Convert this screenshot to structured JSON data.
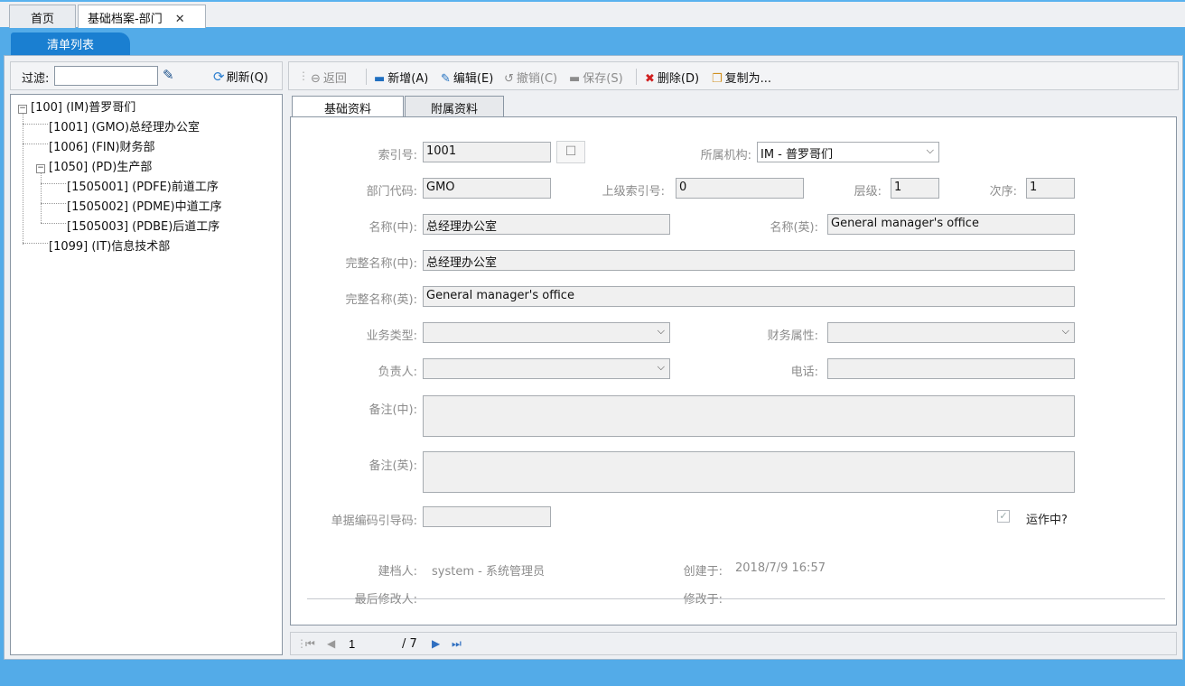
{
  "doc_tabs": [
    {
      "label": "首页"
    },
    {
      "label": "基础档案-部门"
    }
  ],
  "list_tab": "清单列表",
  "filter": {
    "label": "过滤:",
    "value": "",
    "refresh": "刷新(Q)"
  },
  "tree": [
    {
      "label": "[100] (IM)普罗哥们"
    },
    {
      "label": "[1001] (GMO)总经理办公室"
    },
    {
      "label": "[1006] (FIN)财务部"
    },
    {
      "label": "[1050] (PD)生产部"
    },
    {
      "label": "[1505001] (PDFE)前道工序"
    },
    {
      "label": "[1505002] (PDME)中道工序"
    },
    {
      "label": "[1505003] (PDBE)后道工序"
    },
    {
      "label": "[1099] (IT)信息技术部"
    }
  ],
  "toolbar": {
    "back": "返回",
    "add": "新增(A)",
    "edit": "编辑(E)",
    "undo": "撤销(C)",
    "save": "保存(S)",
    "delete": "删除(D)",
    "copy": "复制为..."
  },
  "form_tabs": [
    "基础资料",
    "附属资料"
  ],
  "form": {
    "index_label": "索引号:",
    "index_value": "1001",
    "org_label": "所属机构:",
    "org_value": "IM - 普罗哥们",
    "code_label": "部门代码:",
    "code_value": "GMO",
    "parent_label": "上级索引号:",
    "parent_value": "0",
    "level_label": "层级:",
    "level_value": "1",
    "order_label": "次序:",
    "order_value": "1",
    "name_cn_label": "名称(中):",
    "name_cn_value": "总经理办公室",
    "name_en_label": "名称(英):",
    "name_en_value": "General manager's office",
    "full_cn_label": "完整名称(中):",
    "full_cn_value": "总经理办公室",
    "full_en_label": "完整名称(英):",
    "full_en_value": "General manager's office",
    "biz_type_label": "业务类型:",
    "biz_type_value": "",
    "fin_attr_label": "财务属性:",
    "fin_attr_value": "",
    "owner_label": "负责人:",
    "owner_value": "",
    "phone_label": "电话:",
    "phone_value": "",
    "remark_cn_label": "备注(中):",
    "remark_cn_value": "",
    "remark_en_label": "备注(英):",
    "remark_en_value": "",
    "doc_code_label": "单据编码引导码:",
    "doc_code_value": "",
    "active_label": "运作中?",
    "active_checked": true,
    "creator_label": "建档人:",
    "creator_value": "system - 系统管理员",
    "created_label": "创建于:",
    "created_value": "2018/7/9 16:57",
    "modifier_label": "最后修改人:",
    "modifier_value": "",
    "modified_label": "修改于:",
    "modified_value": ""
  },
  "pager": {
    "current": "1",
    "total": "/ 7"
  }
}
